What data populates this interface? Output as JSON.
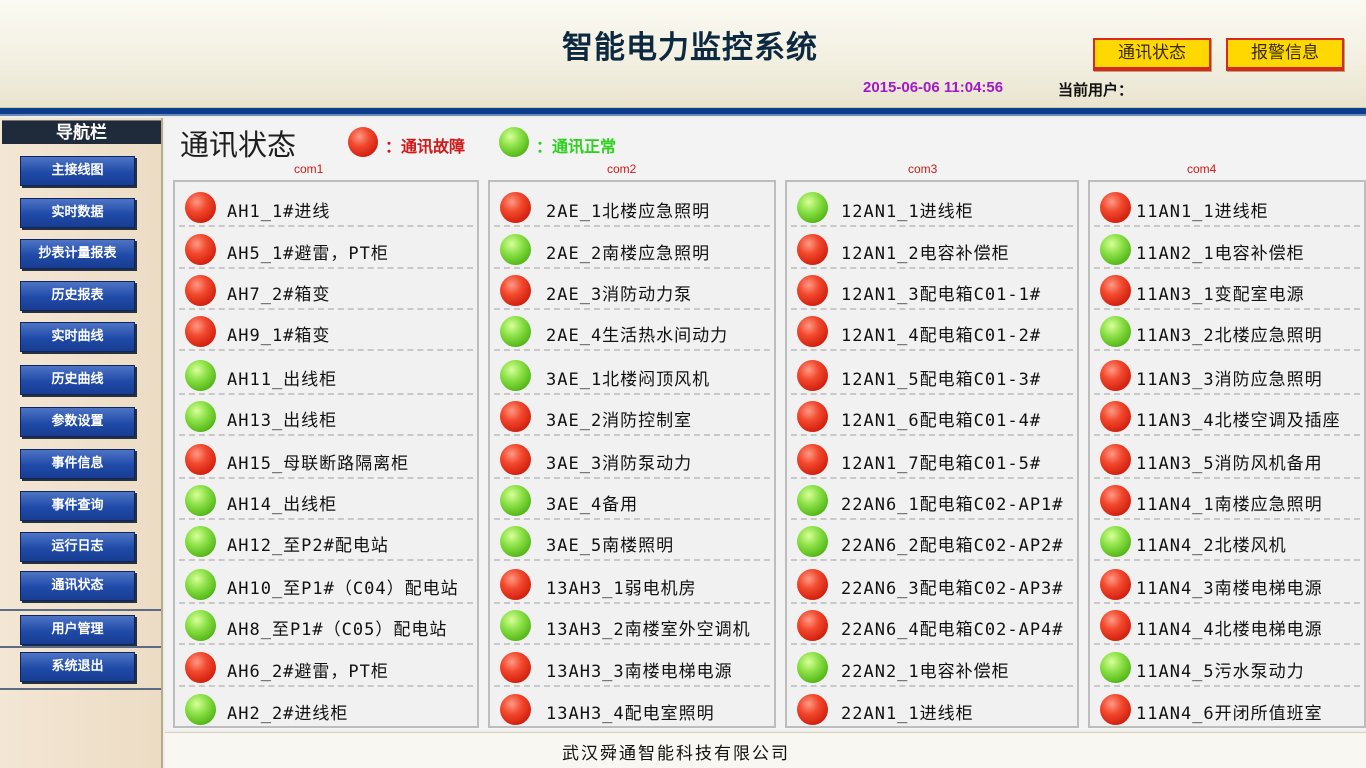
{
  "header": {
    "title": "智能电力监控系统",
    "comm_status_btn": "通讯状态",
    "alarm_btn": "报警信息",
    "datetime": "2015-06-06 11:04:56",
    "current_user_label": "当前用户："
  },
  "sidebar": {
    "title": "导航栏",
    "items": [
      {
        "label": "主接线图"
      },
      {
        "label": "实时数据"
      },
      {
        "label": "抄表计量报表"
      },
      {
        "label": "历史报表"
      },
      {
        "label": "实时曲线"
      },
      {
        "label": "历史曲线"
      },
      {
        "label": "参数设置"
      },
      {
        "label": "事件信息"
      },
      {
        "label": "事件查询"
      },
      {
        "label": "运行日志"
      },
      {
        "label": "通讯状态"
      },
      {
        "label": "用户管理"
      },
      {
        "label": "系统退出"
      }
    ]
  },
  "main": {
    "page_title": "通讯状态",
    "legend_fault": "：通讯故障",
    "legend_ok": "：通讯正常",
    "colors": {
      "fault": "#e2341c",
      "ok": "#6fcd2a"
    },
    "columns": [
      {
        "name": "com1",
        "items": [
          {
            "label": "AH1_1#进线",
            "status": "fault"
          },
          {
            "label": "AH5_1#避雷，PT柜",
            "status": "fault"
          },
          {
            "label": "AH7_2#箱变",
            "status": "fault"
          },
          {
            "label": "AH9_1#箱变",
            "status": "fault"
          },
          {
            "label": "AH11_出线柜",
            "status": "ok"
          },
          {
            "label": "AH13_出线柜",
            "status": "ok"
          },
          {
            "label": "AH15_母联断路隔离柜",
            "status": "fault"
          },
          {
            "label": "AH14_出线柜",
            "status": "ok"
          },
          {
            "label": "AH12_至P2#配电站",
            "status": "ok"
          },
          {
            "label": "AH10_至P1#（C04）配电站",
            "status": "ok"
          },
          {
            "label": "AH8_至P1#（C05）配电站",
            "status": "ok"
          },
          {
            "label": "AH6_2#避雷，PT柜",
            "status": "fault"
          },
          {
            "label": "AH2_2#进线柜",
            "status": "ok"
          }
        ]
      },
      {
        "name": "com2",
        "items": [
          {
            "label": "2AE_1北楼应急照明",
            "status": "fault"
          },
          {
            "label": "2AE_2南楼应急照明",
            "status": "ok"
          },
          {
            "label": "2AE_3消防动力泵",
            "status": "fault"
          },
          {
            "label": "2AE_4生活热水间动力",
            "status": "ok"
          },
          {
            "label": "3AE_1北楼闷顶风机",
            "status": "ok"
          },
          {
            "label": "3AE_2消防控制室",
            "status": "fault"
          },
          {
            "label": "3AE_3消防泵动力",
            "status": "fault"
          },
          {
            "label": "3AE_4备用",
            "status": "ok"
          },
          {
            "label": "3AE_5南楼照明",
            "status": "ok"
          },
          {
            "label": "13AH3_1弱电机房",
            "status": "fault"
          },
          {
            "label": "13AH3_2南楼室外空调机",
            "status": "ok"
          },
          {
            "label": "13AH3_3南楼电梯电源",
            "status": "fault"
          },
          {
            "label": "13AH3_4配电室照明",
            "status": "fault"
          }
        ]
      },
      {
        "name": "com3",
        "items": [
          {
            "label": "12AN1_1进线柜",
            "status": "ok"
          },
          {
            "label": "12AN1_2电容补偿柜",
            "status": "fault"
          },
          {
            "label": "12AN1_3配电箱C01-1#",
            "status": "fault"
          },
          {
            "label": "12AN1_4配电箱C01-2#",
            "status": "fault"
          },
          {
            "label": "12AN1_5配电箱C01-3#",
            "status": "fault"
          },
          {
            "label": "12AN1_6配电箱C01-4#",
            "status": "fault"
          },
          {
            "label": "12AN1_7配电箱C01-5#",
            "status": "fault"
          },
          {
            "label": "22AN6_1配电箱C02-AP1#",
            "status": "ok"
          },
          {
            "label": "22AN6_2配电箱C02-AP2#",
            "status": "ok"
          },
          {
            "label": "22AN6_3配电箱C02-AP3#",
            "status": "fault"
          },
          {
            "label": "22AN6_4配电箱C02-AP4#",
            "status": "fault"
          },
          {
            "label": "22AN2_1电容补偿柜",
            "status": "ok"
          },
          {
            "label": "22AN1_1进线柜",
            "status": "fault"
          }
        ]
      },
      {
        "name": "com4",
        "items": [
          {
            "label": "11AN1_1进线柜",
            "status": "fault"
          },
          {
            "label": "11AN2_1电容补偿柜",
            "status": "ok"
          },
          {
            "label": "11AN3_1变配室电源",
            "status": "fault"
          },
          {
            "label": "11AN3_2北楼应急照明",
            "status": "ok"
          },
          {
            "label": "11AN3_3消防应急照明",
            "status": "fault"
          },
          {
            "label": "11AN3_4北楼空调及插座",
            "status": "fault"
          },
          {
            "label": "11AN3_5消防风机备用",
            "status": "fault"
          },
          {
            "label": "11AN4_1南楼应急照明",
            "status": "fault"
          },
          {
            "label": "11AN4_2北楼风机",
            "status": "ok"
          },
          {
            "label": "11AN4_3南楼电梯电源",
            "status": "fault"
          },
          {
            "label": "11AN4_4北楼电梯电源",
            "status": "fault"
          },
          {
            "label": "11AN4_5污水泵动力",
            "status": "ok"
          },
          {
            "label": "11AN4_6开闭所值班室",
            "status": "fault"
          }
        ]
      }
    ]
  },
  "footer": {
    "company": "武汉舜通智能科技有限公司"
  }
}
